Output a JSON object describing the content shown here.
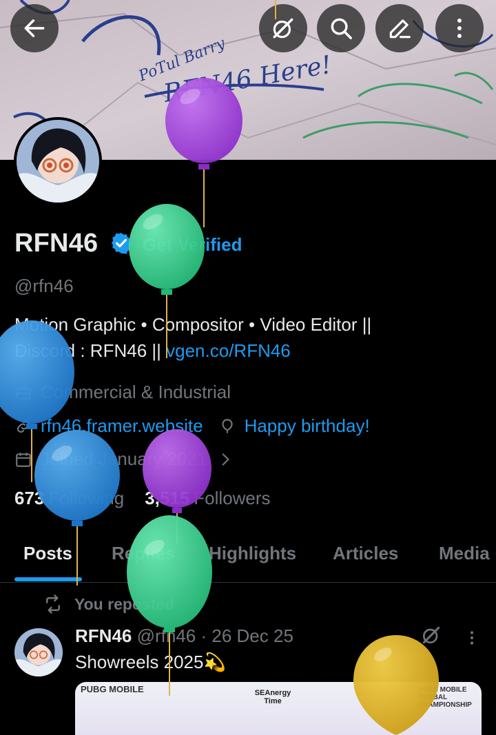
{
  "header": {
    "buttons": [
      {
        "name": "back-button",
        "icon": "arrow-left-icon"
      },
      {
        "name": "grok-button",
        "icon": "grok-icon"
      },
      {
        "name": "search-button",
        "icon": "search-icon"
      },
      {
        "name": "edit-button",
        "icon": "pen-icon"
      },
      {
        "name": "more-button",
        "icon": "more-vertical-icon"
      }
    ]
  },
  "profile": {
    "name": "RFN46",
    "get_verified": "Get Verified",
    "handle": "@rfn46",
    "bio_line1": "Motion Graphic • Compositor • Video Editor ||",
    "bio_line2_prefix": "Discord : RFN46 || ",
    "bio_link": "vgen.co/RFN46",
    "category": "Commercial & Industrial",
    "website": "rfn46.framer.website",
    "birthday": "Happy birthday!",
    "joined": "Joined January 2021",
    "following_count": "673",
    "following_label": "Following",
    "followers_count": "3,515",
    "followers_label": "Followers"
  },
  "tabs": [
    "Posts",
    "Replies",
    "Highlights",
    "Articles",
    "Media"
  ],
  "active_tab": "Posts",
  "post": {
    "repost_label": "You reposted",
    "author": "RFN46",
    "handle": "@rfn46",
    "separator": "·",
    "date": "26 Dec 25",
    "text": "Showreels 2025💫",
    "media_logo_left": "PUBG MOBILE",
    "media_logo_mid": "SEAnergy Time",
    "media_logo_right": "PUBG MOBILE GLOBAL CHAMPIONSHIP"
  },
  "banner_text": [
    "PoTul Barry",
    "RFN46 Here!"
  ],
  "colors": {
    "accent": "#1d9bf0",
    "text": "#e7e9ea",
    "muted": "#71767b",
    "background": "#000000",
    "balloon_purple": "#9b3fd6",
    "balloon_green": "#2fd08e",
    "balloon_blue": "#2b8fe0",
    "balloon_yellow": "#e2b62a"
  }
}
